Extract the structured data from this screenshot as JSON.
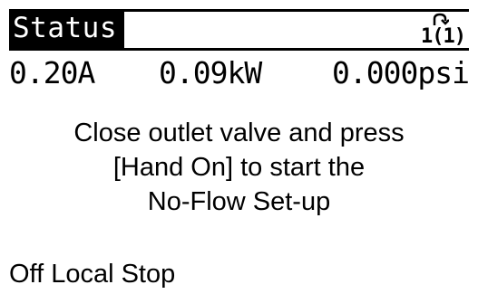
{
  "header": {
    "title": "Status",
    "menu_number": "1(1)",
    "menu_icon": "menu-indicator-icon"
  },
  "readout": {
    "current": "0.20A",
    "power": "0.09kW",
    "pressure": "0.000psi"
  },
  "message": {
    "line1": "Close outlet valve and press",
    "line2": "[Hand On] to start the",
    "line3": "No-Flow Set-up"
  },
  "status_line": {
    "text": "Off Local Stop"
  },
  "colors": {
    "foreground": "#000000",
    "background": "#ffffff"
  }
}
